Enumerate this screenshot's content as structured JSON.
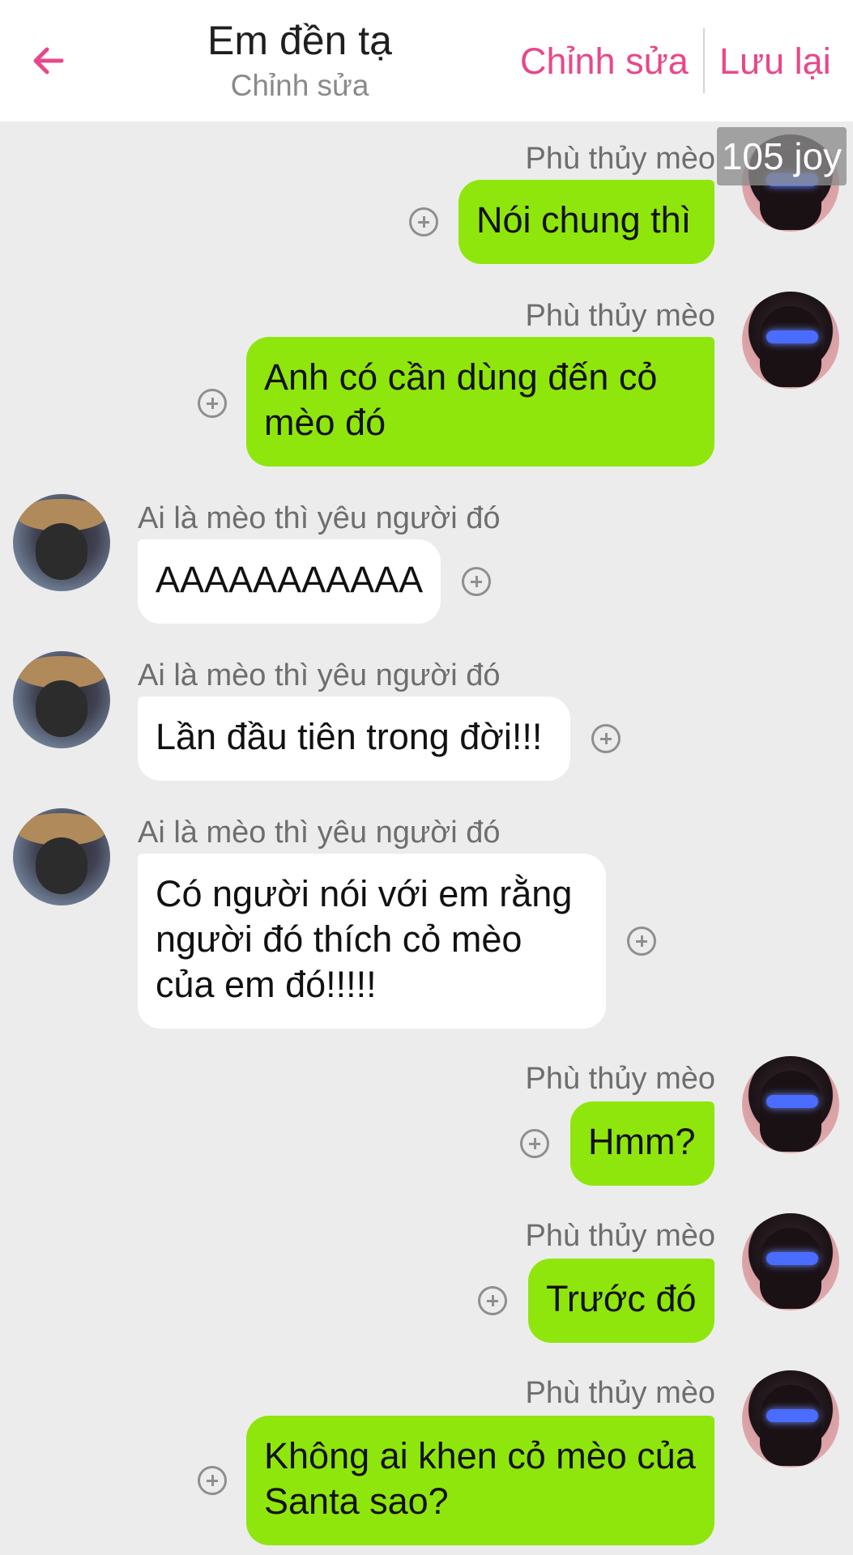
{
  "header": {
    "title": "Em đền tạ",
    "subtitle": "Chỉnh sửa",
    "edit_label": "Chỉnh sửa",
    "save_label": "Lưu lại",
    "back_icon": "arrow-left-icon",
    "accent_color": "#e8478a"
  },
  "badge": {
    "text": "105 joy"
  },
  "colors": {
    "sent_bubble": "#8fe60c",
    "received_bubble": "#ffffff",
    "background": "#ececec"
  },
  "messages": [
    {
      "side": "sent",
      "sender": "Phù thủy mèo",
      "text": "Nói chung thì"
    },
    {
      "side": "sent",
      "sender": "Phù thủy mèo",
      "text": "Anh có cần dùng đến cỏ mèo đó"
    },
    {
      "side": "received",
      "sender": "Ai là mèo thì yêu người đó",
      "text": "AAAAAAAAAAA"
    },
    {
      "side": "received",
      "sender": "Ai là mèo thì yêu người đó",
      "text": "Lần đầu tiên trong đời!!!"
    },
    {
      "side": "received",
      "sender": "Ai là mèo thì yêu người đó",
      "text": "Có người nói với em rằng người đó thích cỏ mèo của em đó!!!!!"
    },
    {
      "side": "sent",
      "sender": "Phù thủy mèo",
      "text": "Hmm?"
    },
    {
      "side": "sent",
      "sender": "Phù thủy mèo",
      "text": "Trước đó"
    },
    {
      "side": "sent",
      "sender": "Phù thủy mèo",
      "text": "Không ai khen cỏ mèo của Santa sao?"
    }
  ]
}
